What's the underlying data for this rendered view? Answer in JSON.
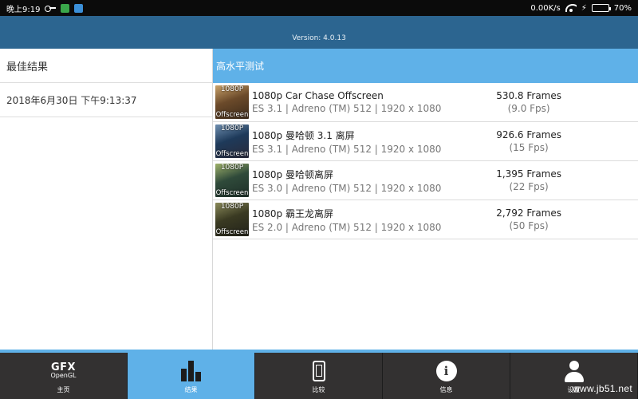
{
  "status_bar": {
    "time": "晚上9:19",
    "network_speed": "0.00K/s",
    "battery_percent": "70%",
    "battery_level": 0.7,
    "icons": [
      "key-icon",
      "app-notification-icon",
      "telegram-icon",
      "wifi-icon",
      "charging-icon",
      "battery-icon"
    ]
  },
  "header": {
    "version": "Version: 4.0.13"
  },
  "left_panel": {
    "title": "最佳结果",
    "date": "2018年6月30日 下午9:13:37"
  },
  "results": {
    "title": "高水平测试",
    "items": [
      {
        "name": "1080p Car Chase Offscreen",
        "details": "ES 3.1 | Adreno (TM) 512 | 1920 x 1080",
        "frames": "530.8 Frames",
        "fps": "(9.0 Fps)",
        "thumb_top": "1080P",
        "thumb_bottom": "Offscreen",
        "thumb_colors": [
          "#6b4a2a",
          "#c9a26a",
          "#3b2a1a"
        ]
      },
      {
        "name": "1080p 曼哈顿 3.1 离屏",
        "details": "ES 3.1 | Adreno (TM) 512 | 1920 x 1080",
        "frames": "926.6 Frames",
        "fps": "(15 Fps)",
        "thumb_top": "1080P",
        "thumb_bottom": "Offscreen",
        "thumb_colors": [
          "#1e3a5a",
          "#6f8fb0",
          "#2a2a3a"
        ]
      },
      {
        "name": "1080p 曼哈顿离屏",
        "details": "ES 3.0 | Adreno (TM) 512 | 1920 x 1080",
        "frames": "1,395 Frames",
        "fps": "(22 Fps)",
        "thumb_top": "1080P",
        "thumb_bottom": "Offscreen",
        "thumb_colors": [
          "#2f4a3a",
          "#9fb26a",
          "#1e2e28"
        ]
      },
      {
        "name": "1080p 霸王龙离屏",
        "details": "ES 2.0 | Adreno (TM) 512 | 1920 x 1080",
        "frames": "2,792 Frames",
        "fps": "(50 Fps)",
        "thumb_top": "1080P",
        "thumb_bottom": "Offscreen",
        "thumb_colors": [
          "#3a3a22",
          "#8a8a5a",
          "#22221a"
        ]
      }
    ]
  },
  "bottom_nav": {
    "home": {
      "label": "主页",
      "logo_top": "GFX",
      "logo_bottom": "OpenGL"
    },
    "results": {
      "label": "结果"
    },
    "compare": {
      "label": "比较"
    },
    "info": {
      "label": "信息",
      "glyph": "i"
    },
    "settings": {
      "label": "设置"
    }
  },
  "watermark": "www.jb51.net",
  "colors": {
    "header": "#2c6590",
    "accent": "#5fb1e8",
    "nav_bg": "#333131"
  }
}
